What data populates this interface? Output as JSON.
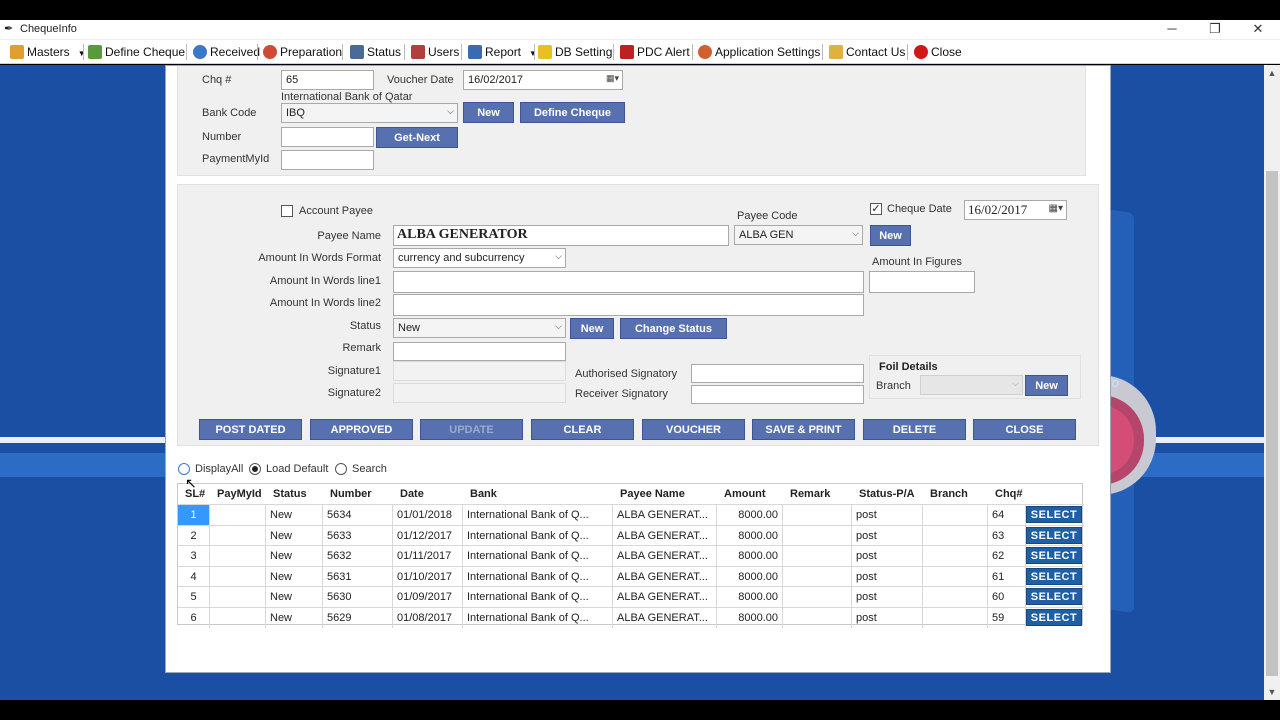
{
  "window": {
    "title": "ChequeInfo",
    "minimize": "─",
    "restore": "❐",
    "close": "✕"
  },
  "menu": [
    {
      "label": "Masters",
      "icon": "home-icon",
      "dropdown": true
    },
    {
      "label": "Define Cheque",
      "icon": "define-cheque-icon"
    },
    {
      "label": "Received",
      "icon": "received-icon"
    },
    {
      "label": "Preparation",
      "icon": "preparation-icon"
    },
    {
      "label": "Status",
      "icon": "monitor-icon"
    },
    {
      "label": "Users",
      "icon": "users-icon"
    },
    {
      "label": "Report",
      "icon": "report-chart-icon",
      "dropdown": true
    },
    {
      "label": "DB Setting",
      "icon": "lightning-icon"
    },
    {
      "label": "PDC Alert",
      "icon": "flag-icon"
    },
    {
      "label": "Application Settings",
      "icon": "gear-icon"
    },
    {
      "label": "Contact Us",
      "icon": "envelope-icon"
    },
    {
      "label": "Close",
      "icon": "stop-icon"
    }
  ],
  "top": {
    "chq_label": "Chq #",
    "chq_value": "65",
    "voucher_date_label": "Voucher Date",
    "voucher_date_value": "16/02/2017",
    "bank_name": "International Bank of Qatar",
    "bank_code_label": "Bank Code",
    "bank_code_value": "IBQ",
    "new_label": "New",
    "define_cheque_label": "Define Cheque",
    "number_label": "Number",
    "number_value": "",
    "get_next_label": "Get-Next",
    "payment_myid_label": "PaymentMyId",
    "payment_myid_value": ""
  },
  "details": {
    "account_payee_label": "Account Payee",
    "account_payee_checked": false,
    "payee_code_label": "Payee Code",
    "payee_code_value": "ALBA GEN",
    "payee_new_label": "New",
    "cheque_date_label": "Cheque Date",
    "cheque_date_checked": true,
    "cheque_date_value": "16/02/2017",
    "payee_name_label": "Payee Name",
    "payee_name_value": "ALBA GENERATOR",
    "words_format_label": "Amount In Words Format",
    "words_format_value": "currency and subcurrency",
    "amount_figures_label": "Amount In Figures",
    "amount_figures_value": "",
    "words_line1_label": "Amount In Words line1",
    "words_line1_value": "",
    "words_line2_label": "Amount In Words line2",
    "words_line2_value": "",
    "status_label": "Status",
    "status_value": "New",
    "status_new_label": "New",
    "change_status_label": "Change Status",
    "remark_label": "Remark",
    "remark_value": "",
    "signature1_label": "Signature1",
    "signature2_label": "Signature2",
    "auth_sig_label": "Authorised Signatory",
    "auth_sig_value": "",
    "recv_sig_label": "Receiver Signatory",
    "recv_sig_value": "",
    "foil_label": "Foil Details",
    "branch_label": "Branch",
    "branch_value": "",
    "branch_new_label": "New"
  },
  "actions": [
    {
      "label": "POST DATED",
      "enabled": true
    },
    {
      "label": "APPROVED",
      "enabled": true
    },
    {
      "label": "UPDATE",
      "enabled": false
    },
    {
      "label": "CLEAR",
      "enabled": true
    },
    {
      "label": "VOUCHER",
      "enabled": true
    },
    {
      "label": "SAVE & PRINT",
      "enabled": true
    },
    {
      "label": "DELETE",
      "enabled": true
    },
    {
      "label": "CLOSE",
      "enabled": true
    }
  ],
  "filters": [
    {
      "label": "DisplayAll",
      "selected": false
    },
    {
      "label": "Load Default",
      "selected": true
    },
    {
      "label": "Search",
      "selected": false
    }
  ],
  "grid": {
    "columns": [
      "SL#",
      "PayMyId",
      "Status",
      "Number",
      "Date",
      "Bank",
      "Payee Name",
      "Amount",
      "Remark",
      "Status-P/A",
      "Branch",
      "Chq#",
      ""
    ],
    "select_label": "SELECT",
    "rows": [
      {
        "sl": "1",
        "paymyid": "",
        "status": "New",
        "number": "5634",
        "date": "01/01/2018",
        "bank": "International Bank of Q...",
        "payee": "ALBA GENERAT...",
        "amount": "8000.00",
        "remark": "",
        "spa": "post",
        "branch": "",
        "chq": "64"
      },
      {
        "sl": "2",
        "paymyid": "",
        "status": "New",
        "number": "5633",
        "date": "01/12/2017",
        "bank": "International Bank of Q...",
        "payee": "ALBA GENERAT...",
        "amount": "8000.00",
        "remark": "",
        "spa": "post",
        "branch": "",
        "chq": "63"
      },
      {
        "sl": "3",
        "paymyid": "",
        "status": "New",
        "number": "5632",
        "date": "01/11/2017",
        "bank": "International Bank of Q...",
        "payee": "ALBA GENERAT...",
        "amount": "8000.00",
        "remark": "",
        "spa": "post",
        "branch": "",
        "chq": "62"
      },
      {
        "sl": "4",
        "paymyid": "",
        "status": "New",
        "number": "5631",
        "date": "01/10/2017",
        "bank": "International Bank of Q...",
        "payee": "ALBA GENERAT...",
        "amount": "8000.00",
        "remark": "",
        "spa": "post",
        "branch": "",
        "chq": "61"
      },
      {
        "sl": "5",
        "paymyid": "",
        "status": "New",
        "number": "5630",
        "date": "01/09/2017",
        "bank": "International Bank of Q...",
        "payee": "ALBA GENERAT...",
        "amount": "8000.00",
        "remark": "",
        "spa": "post",
        "branch": "",
        "chq": "60"
      },
      {
        "sl": "6",
        "paymyid": "",
        "status": "New",
        "number": "5629",
        "date": "01/08/2017",
        "bank": "International Bank of Q...",
        "payee": "ALBA GENERAT...",
        "amount": "8000.00",
        "remark": "",
        "spa": "post",
        "branch": "",
        "chq": "59"
      }
    ]
  },
  "colors": {
    "button": "#5770b0",
    "select_button": "#1f5fa6",
    "desktop": "#1a4fa3",
    "row_highlight": "#3399ff"
  }
}
